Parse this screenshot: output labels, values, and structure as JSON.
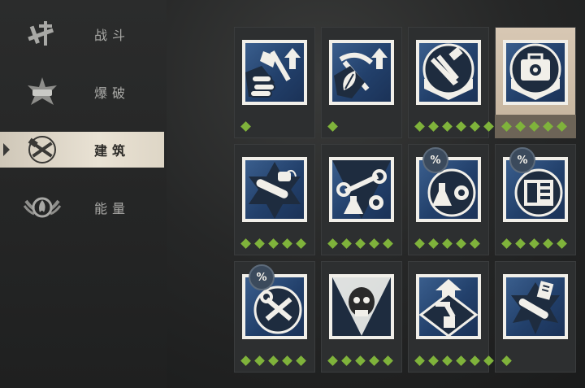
{
  "sidebar": {
    "items": [
      {
        "label": "战斗",
        "icon": "combat-icon",
        "active": false
      },
      {
        "label": "爆破",
        "icon": "explosives-icon",
        "active": false
      },
      {
        "label": "建筑",
        "icon": "construction-icon",
        "active": true
      },
      {
        "label": "能量",
        "icon": "energy-icon",
        "active": false
      }
    ]
  },
  "skills": [
    {
      "icon": "axe-logs-upgrade-icon",
      "level": 1,
      "max": 1,
      "discount": false,
      "selected": false
    },
    {
      "icon": "pickaxe-leaf-upgrade-icon",
      "level": 1,
      "max": 1,
      "discount": false,
      "selected": false
    },
    {
      "icon": "hammer-saw-downgrade-icon",
      "level": 6,
      "max": 6,
      "discount": false,
      "selected": false
    },
    {
      "icon": "toolbox-gear-downgrade-icon",
      "level": 5,
      "max": 5,
      "discount": false,
      "selected": true
    },
    {
      "icon": "chainsaw-icon",
      "level": 5,
      "max": 5,
      "discount": false,
      "selected": false
    },
    {
      "icon": "wrench-flask-gear-icon",
      "level": 5,
      "max": 5,
      "discount": false,
      "selected": false
    },
    {
      "icon": "flask-gear-percent-icon",
      "level": 5,
      "max": 5,
      "discount": true,
      "discount_label": "%",
      "selected": false
    },
    {
      "icon": "workbench-percent-icon",
      "level": 5,
      "max": 5,
      "discount": true,
      "discount_label": "%",
      "selected": false
    },
    {
      "icon": "wrench-screwdriver-percent-icon",
      "level": 5,
      "max": 5,
      "discount": true,
      "discount_label": "%",
      "selected": false
    },
    {
      "icon": "skull-icon",
      "level": 5,
      "max": 5,
      "discount": false,
      "selected": false
    },
    {
      "icon": "robot-arm-upgrade-icon",
      "level": 6,
      "max": 6,
      "discount": false,
      "selected": false
    },
    {
      "icon": "chainsaw-blueprint-icon",
      "level": 1,
      "max": 1,
      "discount": false,
      "selected": false
    }
  ],
  "colors": {
    "star": "#7fb33b",
    "art_blue": "#2a4a78",
    "selected": "#d8c8b4"
  }
}
